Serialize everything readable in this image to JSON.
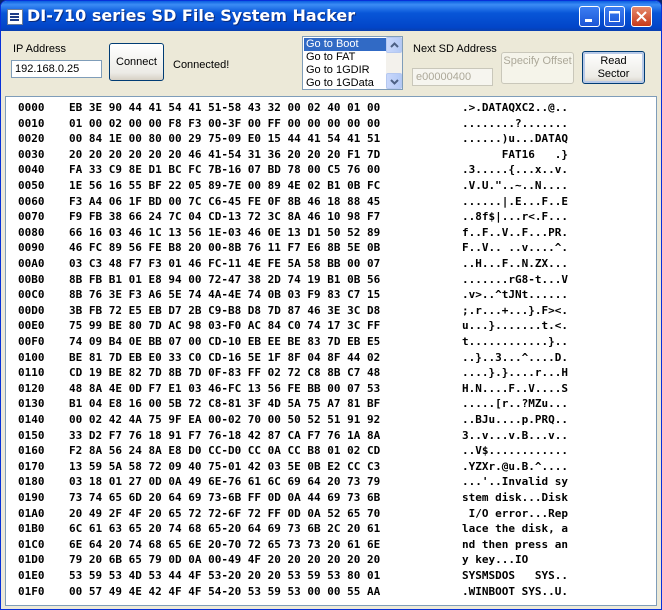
{
  "window": {
    "title": "DI-710 series SD File System Hacker"
  },
  "connection": {
    "ip_label": "IP Address",
    "ip_value": "192.168.0.25",
    "connect_label": "Connect",
    "status": "Connected!"
  },
  "goto_list": {
    "items": [
      "Go to Boot",
      "Go to FAT",
      "Go to 1GDIR",
      "Go to 1GData"
    ],
    "selected": "Go to Boot"
  },
  "sd_address": {
    "label": "Next SD Address",
    "value": "e00000400"
  },
  "buttons": {
    "specify_offset": "Specify Offset",
    "read_sector": "Read Sector"
  },
  "icons": [
    "app-icon",
    "minimize-icon",
    "maximize-icon",
    "close-icon",
    "scroll-up-icon",
    "scroll-down-icon"
  ],
  "colors": {
    "titlebar": "#0a5ee0",
    "selection": "#316ac5",
    "close_button": "#c7391a"
  },
  "hex_rows": [
    {
      "addr": "0000",
      "bytes": "EB 3E 90 44 41 54 41 51-58 43 32 00 02 40 01 00",
      "ascii": ".>.DATAQXC2..@.."
    },
    {
      "addr": "0010",
      "bytes": "01 00 02 00 00 F8 F3 00-3F 00 FF 00 00 00 00 00",
      "ascii": "........?......."
    },
    {
      "addr": "0020",
      "bytes": "00 84 1E 00 80 00 29 75-09 E0 15 44 41 54 41 51",
      "ascii": "......)u...DATAQ"
    },
    {
      "addr": "0030",
      "bytes": "20 20 20 20 20 20 46 41-54 31 36 20 20 20 F1 7D",
      "ascii": "      FAT16   .}"
    },
    {
      "addr": "0040",
      "bytes": "FA 33 C9 8E D1 BC FC 7B-16 07 BD 78 00 C5 76 00",
      "ascii": ".3.....{...x..v."
    },
    {
      "addr": "0050",
      "bytes": "1E 56 16 55 BF 22 05 89-7E 00 89 4E 02 B1 0B FC",
      "ascii": ".V.U.\"..~..N...."
    },
    {
      "addr": "0060",
      "bytes": "F3 A4 06 1F BD 00 7C C6-45 FE 0F 8B 46 18 88 45",
      "ascii": "......|.E...F..E"
    },
    {
      "addr": "0070",
      "bytes": "F9 FB 38 66 24 7C 04 CD-13 72 3C 8A 46 10 98 F7",
      "ascii": "..8f$|...r<.F..."
    },
    {
      "addr": "0080",
      "bytes": "66 16 03 46 1C 13 56 1E-03 46 0E 13 D1 50 52 89",
      "ascii": "f..F..V..F...PR."
    },
    {
      "addr": "0090",
      "bytes": "46 FC 89 56 FE B8 20 00-8B 76 11 F7 E6 8B 5E 0B",
      "ascii": "F..V.. ..v....^."
    },
    {
      "addr": "00A0",
      "bytes": "03 C3 48 F7 F3 01 46 FC-11 4E FE 5A 58 BB 00 07",
      "ascii": "..H...F..N.ZX..."
    },
    {
      "addr": "00B0",
      "bytes": "8B FB B1 01 E8 94 00 72-47 38 2D 74 19 B1 0B 56",
      "ascii": ".......rG8-t...V"
    },
    {
      "addr": "00C0",
      "bytes": "8B 76 3E F3 A6 5E 74 4A-4E 74 0B 03 F9 83 C7 15",
      "ascii": ".v>..^tJNt......"
    },
    {
      "addr": "00D0",
      "bytes": "3B FB 72 E5 EB D7 2B C9-B8 D8 7D 87 46 3E 3C D8",
      "ascii": ";.r...+...}.F><."
    },
    {
      "addr": "00E0",
      "bytes": "75 99 BE 80 7D AC 98 03-F0 AC 84 C0 74 17 3C FF",
      "ascii": "u...}.......t.<."
    },
    {
      "addr": "00F0",
      "bytes": "74 09 B4 0E BB 07 00 CD-10 EB EE BE 83 7D EB E5",
      "ascii": "t............}.."
    },
    {
      "addr": "0100",
      "bytes": "BE 81 7D EB E0 33 C0 CD-16 5E 1F 8F 04 8F 44 02",
      "ascii": "..}..3...^....D."
    },
    {
      "addr": "0110",
      "bytes": "CD 19 BE 82 7D 8B 7D 0F-83 FF 02 72 C8 8B C7 48",
      "ascii": "....}.}....r...H"
    },
    {
      "addr": "0120",
      "bytes": "48 8A 4E 0D F7 E1 03 46-FC 13 56 FE BB 00 07 53",
      "ascii": "H.N....F..V....S"
    },
    {
      "addr": "0130",
      "bytes": "B1 04 E8 16 00 5B 72 C8-81 3F 4D 5A 75 A7 81 BF",
      "ascii": ".....[r..?MZu..."
    },
    {
      "addr": "0140",
      "bytes": "00 02 42 4A 75 9F EA 00-02 70 00 50 52 51 91 92",
      "ascii": "..BJu....p.PRQ.."
    },
    {
      "addr": "0150",
      "bytes": "33 D2 F7 76 18 91 F7 76-18 42 87 CA F7 76 1A 8A",
      "ascii": "3..v...v.B...v.."
    },
    {
      "addr": "0160",
      "bytes": "F2 8A 56 24 8A E8 D0 CC-D0 CC 0A CC B8 01 02 CD",
      "ascii": "..V$............"
    },
    {
      "addr": "0170",
      "bytes": "13 59 5A 58 72 09 40 75-01 42 03 5E 0B E2 CC C3",
      "ascii": ".YZXr.@u.B.^...."
    },
    {
      "addr": "0180",
      "bytes": "03 18 01 27 0D 0A 49 6E-76 61 6C 69 64 20 73 79",
      "ascii": "...'..Invalid sy"
    },
    {
      "addr": "0190",
      "bytes": "73 74 65 6D 20 64 69 73-6B FF 0D 0A 44 69 73 6B",
      "ascii": "stem disk...Disk"
    },
    {
      "addr": "01A0",
      "bytes": "20 49 2F 4F 20 65 72 72-6F 72 FF 0D 0A 52 65 70",
      "ascii": " I/O error...Rep"
    },
    {
      "addr": "01B0",
      "bytes": "6C 61 63 65 20 74 68 65-20 64 69 73 6B 2C 20 61",
      "ascii": "lace the disk, a"
    },
    {
      "addr": "01C0",
      "bytes": "6E 64 20 74 68 65 6E 20-70 72 65 73 73 20 61 6E",
      "ascii": "nd then press an"
    },
    {
      "addr": "01D0",
      "bytes": "79 20 6B 65 79 0D 0A 00-49 4F 20 20 20 20 20 20",
      "ascii": "y key...IO      "
    },
    {
      "addr": "01E0",
      "bytes": "53 59 53 4D 53 44 4F 53-20 20 20 53 59 53 80 01",
      "ascii": "SYSMSDOS   SYS.."
    },
    {
      "addr": "01F0",
      "bytes": "00 57 49 4E 42 4F 4F 54-20 53 59 53 00 00 55 AA",
      "ascii": ".WINBOOT SYS..U."
    }
  ]
}
